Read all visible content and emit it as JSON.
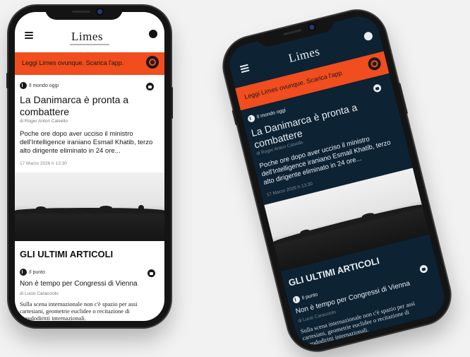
{
  "app": {
    "logo": "Limes",
    "banner_text": "Leggi Limes ovunque. Scarica l'app.",
    "colors": {
      "accent": "#f14d1e",
      "dark_bg": "#0d2233"
    }
  },
  "light": {
    "article": {
      "category": "Il mondo oggi",
      "title": "La Danimarca è pronta a combattere",
      "byline": "di Roger Anton Calvello",
      "lead": "Poche ore dopo aver ucciso il ministro dell'Intelligence iraniano Esmail Khatib, terzo alto dirigente eliminato in 24 ore...",
      "date": "17 Marzo 2026 h 13:30"
    },
    "section_title": "GLI ULTIMI ARTICOLI",
    "next": {
      "category": "Il punto",
      "title": "Non è tempo per Congressi di Vienna",
      "byline": "di Lucio Caracciolo",
      "excerpt": "Sulla scena internazionale non c'è spazio per assi cartesiani, geometrie euclidee o recitazione di pseudodiritti internazionali."
    }
  },
  "dark": {
    "article": {
      "category": "Il mondo oggi",
      "title": "La Danimarca è pronta a combattere",
      "byline": "di Roger Anton Calvello",
      "lead": "Poche ore dopo aver ucciso il ministro dell'Intelligence iraniano Esmail Khatib, terzo alto dirigente eliminato in 24 ore...",
      "date": "17 Marzo 2026 h 13:30"
    },
    "section_title": "GLI ULTIMI ARTICOLI",
    "next": {
      "category": "Il punto",
      "title": "Non è tempo per Congressi di Vienna",
      "byline": "di Lucio Caracciolo",
      "excerpt": "Sulla scena internazionale non c'è spazio per assi cartesiani, geometrie euclidee o recitazione di pseudodiritti internazionali."
    }
  }
}
